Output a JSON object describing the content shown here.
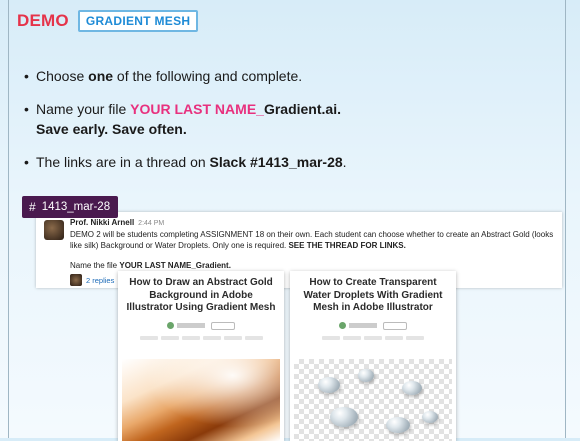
{
  "header": {
    "demo": "DEMO",
    "badge": "GRADIENT MESH"
  },
  "bullets": {
    "b1_pre": "Choose ",
    "b1_bold": "one",
    "b1_post": " of the following and complete.",
    "b2_pre": "Name your file ",
    "b2_pink": "YOUR LAST NAME_",
    "b2_bold": "Gradient.ai.",
    "b2_line2": "Save early. Save often.",
    "b3_pre": "The links are in a thread on ",
    "b3_bold": "Slack #1413_mar-28",
    "b3_post": "."
  },
  "slack": {
    "channel": "1413_mar-28",
    "sender": "Prof. Nikki Arnell",
    "time": "2:44 PM",
    "message_1": "DEMO 2 will be students completing ASSIGNMENT 18 on their own. Each student can choose whether to create an Abstract Gold (looks like silk) Background or Water Droplets. Only one is required. ",
    "message_bold": "SEE THE THREAD FOR LINKS.",
    "name_line_pre": "Name the file ",
    "name_line_bold": "YOUR LAST NAME_Gradient.",
    "replies": "2 replies"
  },
  "articles": [
    {
      "title": "How to Draw an Abstract Gold Background in Adobe Illustrator Using Gradient Mesh"
    },
    {
      "title": "How to Create Transparent Water Droplets With Gradient Mesh in Adobe Illustrator"
    }
  ],
  "colors": {
    "demo": "#e5334a",
    "pink": "#e8317e",
    "badge": "#1e8bd6",
    "slack_tag": "#4a1a4f"
  }
}
